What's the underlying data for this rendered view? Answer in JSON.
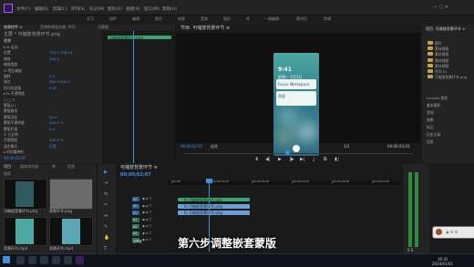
{
  "menu": [
    "文件(F)",
    "编辑(E)",
    "剪辑(C)",
    "序列(S)",
    "标记(M)",
    "图形(G)",
    "视图(V)",
    "窗口(W)",
    "帮助(H)"
  ],
  "workspace_tabs": [
    "学习",
    "组件",
    "编辑",
    "颜色",
    "效果",
    "音频",
    "图形",
    "库",
    "一键编辑",
    "素材包",
    "剪辑"
  ],
  "left_panel": {
    "tabs": [
      "效果控件 ≡",
      "音频剪辑混合器: 序列",
      "元数据"
    ],
    "header": "主要 * 可缩放背景环节.png",
    "video_label": "视频",
    "rows": [
      "▸ fx 运动",
      "  位置",
      "  缩放",
      "  缩放宽度",
      "  ☑ 等比缩放",
      "  旋转",
      "  锚点",
      "  防闪烁滤镜",
      "▸ fx 不透明度",
      "  ○ □ ✎",
      "  蒙版(1)",
      "  蒙版路径",
      "  蒙版羽化",
      "  蒙版不透明度",
      "  蒙版扩展",
      "  ☐ 已反转",
      "  不透明度",
      "  混合模式",
      "▸ 时间重映射"
    ],
    "values": [
      "",
      "720.0   1280.0",
      "100.0",
      "",
      "",
      "0.0",
      "360.0  640.0",
      "0.00",
      "",
      "",
      "",
      "",
      "50.0",
      "100.0 %",
      "0.0",
      "",
      "100.0 %",
      "正常",
      ""
    ]
  },
  "mini_timeline": {
    "clip_label": "可缩放背景环节.png",
    "timecode": "00;00;02;07"
  },
  "program": {
    "tab": "节目: 可缩放背景环节 ≡",
    "timecode_left": "00;00;02;07",
    "fit_label": "适合",
    "fraction": "1/2",
    "timecode_right": "00;00;03;03",
    "phone_time": "9:41",
    "phone_date": "星期一 1月1日",
    "card1": "Focus Workspace",
    "card2": "消息"
  },
  "project": {
    "tab": "项目: 可缩放背景环节 ≡",
    "items": [
      "图片",
      "素材视频",
      "素材视频",
      "素材视频",
      "素材视频",
      "序列 01",
      "可缩放背景环节.png"
    ],
    "sub_tabs": [
      "Lumetri 颜色",
      "基本图形",
      "音频",
      "效果",
      "标记",
      "历史记录",
      "信息"
    ]
  },
  "left_bottom": {
    "tabs": [
      "项目",
      "媒体浏览器",
      "库",
      "信息"
    ],
    "search_placeholder": "搜索",
    "items": [
      "可缩放背景环节.png",
      "可缩放背景环节 5.00",
      "背景环节.png",
      "可缩放背景环节.png",
      "背景环节.mp4",
      "背景环节.mp4"
    ]
  },
  "timeline": {
    "tab": "可缩放背景环节 ≡",
    "timecode": "00;00;02;07",
    "ruler_marks": [
      "00;00",
      "00;00;01;00",
      "00;00;02;00",
      "00;00;03;00",
      "00;00;04;00",
      "00;00;05;00"
    ],
    "tracks": [
      "V3",
      "V2",
      "V1",
      "A1",
      "A2",
      "A3",
      "主声道"
    ],
    "clips": [
      "fx 可缩放背景环节.png",
      "fx 可缩放背景环节.png",
      "fx 可缩放背景环节.png"
    ]
  },
  "subtitle": "第六步调整嵌套蒙版",
  "taskbar": {
    "time": "16:41",
    "date": "2024/01/01"
  },
  "colors": {
    "accent_blue": "#3f8fe0",
    "green_clip": "#3aa46f",
    "blue_clip": "#6b9fd6",
    "panel_bg": "#232323"
  }
}
